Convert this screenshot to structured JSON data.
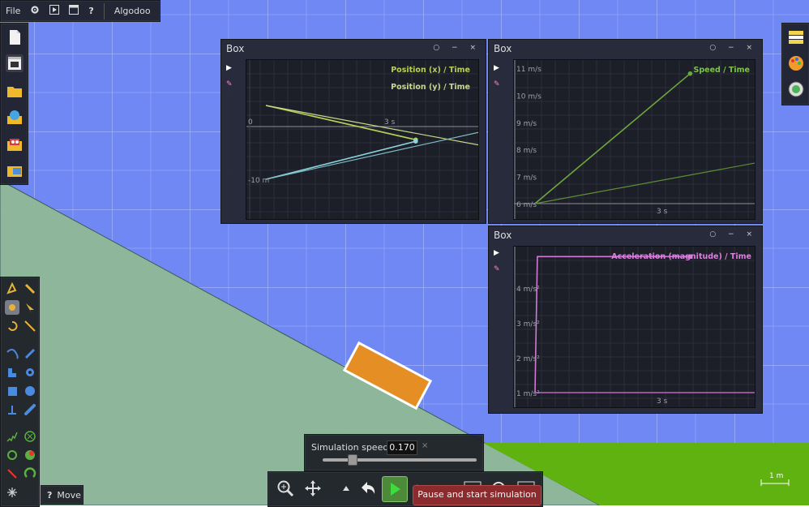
{
  "app": {
    "name": "Algodoo"
  },
  "menubar": {
    "file_label": "File",
    "app_label": "Algodoo",
    "icons": [
      "gear-icon",
      "play-icon",
      "window-icon",
      "help-icon"
    ]
  },
  "graphs": [
    {
      "title": "Box",
      "chart_data": {
        "type": "line",
        "series": [
          {
            "name": "Position (x) / Time",
            "color": "#b9cf5a",
            "x": [
              0,
              3.3
            ],
            "y": [
              4,
              -2.5
            ]
          },
          {
            "name": "Position (y) / Time",
            "color": "#c7d98a",
            "x": [
              0,
              5
            ],
            "y": [
              4,
              -4
            ]
          },
          {
            "name": "",
            "color": "#8ad6e0",
            "x": [
              0,
              3.3
            ],
            "y": [
              -10,
              -2.8
            ]
          },
          {
            "name": "",
            "color": "#7fbcc6",
            "x": [
              0,
              5
            ],
            "y": [
              -10,
              -0.5
            ]
          }
        ],
        "tick_labels_x": [
          "0",
          "3 s"
        ],
        "tick_labels_y": [
          "-10 m"
        ]
      }
    },
    {
      "title": "Box",
      "chart_data": {
        "type": "line",
        "series": [
          {
            "name": "Speed / Time",
            "color": "#6aa83c",
            "x": [
              0,
              3.3
            ],
            "y": [
              6,
              10.8
            ]
          },
          {
            "name": "",
            "color": "#5e8f36",
            "x": [
              0,
              5
            ],
            "y": [
              6,
              7.6
            ]
          }
        ],
        "tick_labels_x": [
          "3 s"
        ],
        "tick_labels_y": [
          "6 m/s",
          "7 m/s",
          "8 m/s",
          "9 m/s",
          "10 m/s",
          "11 m/s"
        ],
        "ylim": [
          6,
          11
        ]
      }
    },
    {
      "title": "Box",
      "chart_data": {
        "type": "line",
        "series": [
          {
            "name": "Acceleration (magnitude) / Time",
            "color": "#d27ad6",
            "x": [
              0,
              0.05,
              0.1,
              3.3
            ],
            "y": [
              1,
              4.9,
              4.9,
              4.9
            ]
          },
          {
            "name": "",
            "color": "#b866c0",
            "x": [
              0,
              5
            ],
            "y": [
              1,
              1
            ]
          }
        ],
        "tick_labels_x": [
          "3 s"
        ],
        "tick_labels_y": [
          "1 m/s²",
          "2 m/s²",
          "3 m/s²",
          "4 m/s²"
        ],
        "ylim": [
          1,
          5
        ]
      }
    }
  ],
  "speed": {
    "label": "Simulation speed:",
    "value": "0.170",
    "close": "×",
    "slider_value": 0.17
  },
  "tooltip": {
    "text": "Pause and start simulation"
  },
  "move": {
    "help": "?",
    "label": "Move"
  },
  "scale": {
    "label": "1 m"
  },
  "colors": {
    "sky": "#7088f4",
    "ground": "#8fb895",
    "grass": "#5fb20f",
    "box": "#e58e24"
  }
}
